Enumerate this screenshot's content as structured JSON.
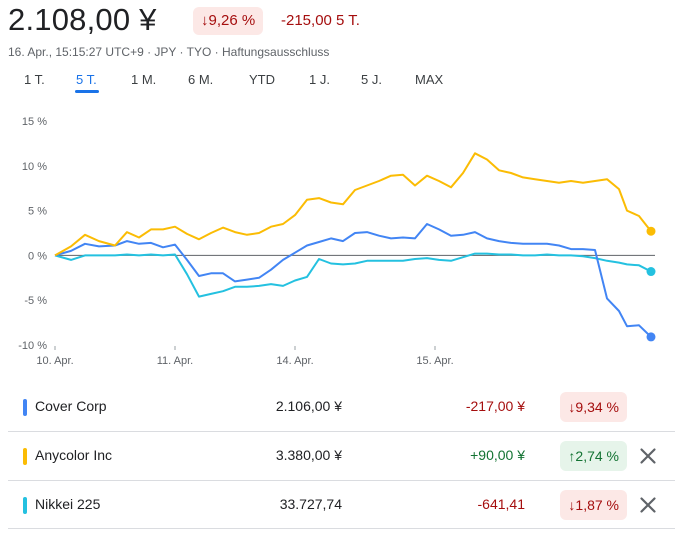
{
  "header": {
    "price": "2.108,00 ¥",
    "percent_change": "9,26 %",
    "abs_change": "-215,00 5 T.",
    "subline": "16. Apr., 15:15:27 UTC+9 · JPY · TYO · Haftungsausschluss",
    "down_color": "#a50e0e"
  },
  "tabs": [
    {
      "label": "1 T.",
      "active": false
    },
    {
      "label": "5 T.",
      "active": true
    },
    {
      "label": "1 M.",
      "active": false
    },
    {
      "label": "6 M.",
      "active": false
    },
    {
      "label": "YTD",
      "active": false
    },
    {
      "label": "1 J.",
      "active": false
    },
    {
      "label": "5 J.",
      "active": false
    },
    {
      "label": "MAX",
      "active": false
    }
  ],
  "chart_data": {
    "type": "line",
    "x_tick_labels": [
      "10. Apr.",
      "11. Apr.",
      "14. Apr.",
      "15. Apr."
    ],
    "x_tick_positions": [
      0,
      6,
      12,
      19
    ],
    "x_range": [
      0,
      30
    ],
    "ylim": [
      -10,
      15
    ],
    "y_ticks": [
      15,
      10,
      5,
      0,
      -5,
      -10
    ],
    "y_tick_labels": [
      "15 %",
      "10 %",
      "5 %",
      "0 %",
      "-5 %",
      "-10 %"
    ],
    "baseline": 0,
    "series": [
      {
        "name": "Cover Corp",
        "color": "#4285f4",
        "x": [
          0,
          0.8,
          1.5,
          2.2,
          3,
          3.6,
          4.2,
          4.8,
          5.4,
          6,
          6.6,
          7.2,
          7.8,
          8.4,
          9,
          9.6,
          10.2,
          10.8,
          11.4,
          12,
          12.6,
          13.2,
          13.8,
          14.4,
          15,
          15.6,
          16.2,
          16.8,
          17.4,
          18,
          18.6,
          19.2,
          19.8,
          20.4,
          21,
          21.6,
          22.2,
          22.8,
          23.4,
          24,
          24.6,
          25.2,
          25.8,
          26.4,
          27,
          27.6,
          28.2,
          28.6,
          29.2,
          29.8
        ],
        "y": [
          0,
          0.5,
          1.3,
          1.0,
          1.1,
          1.6,
          1.3,
          1.4,
          0.9,
          1.2,
          -0.5,
          -2.3,
          -2.0,
          -2.0,
          -2.9,
          -2.7,
          -2.5,
          -1.6,
          -0.5,
          0.3,
          1.1,
          1.5,
          1.9,
          1.6,
          2.5,
          2.6,
          2.2,
          1.9,
          2.0,
          1.9,
          3.5,
          2.9,
          2.2,
          2.3,
          2.6,
          1.9,
          1.6,
          1.4,
          1.3,
          1.3,
          1.3,
          1.1,
          0.7,
          0.7,
          0.6,
          -4.8,
          -6.2,
          -7.9,
          -7.8,
          -9.1
        ]
      },
      {
        "name": "Anycolor Inc",
        "color": "#fbbc04",
        "x": [
          0,
          0.8,
          1.5,
          2.2,
          3,
          3.6,
          4.2,
          4.8,
          5.4,
          6,
          6.6,
          7.2,
          7.8,
          8.4,
          9,
          9.6,
          10.2,
          10.8,
          11.4,
          12,
          12.6,
          13.2,
          13.8,
          14.4,
          15,
          15.6,
          16.2,
          16.8,
          17.4,
          18,
          18.6,
          19.2,
          19.8,
          20.4,
          21,
          21.6,
          22.2,
          22.8,
          23.4,
          24,
          24.6,
          25.2,
          25.8,
          26.4,
          27,
          27.6,
          28.2,
          28.6,
          29.2,
          29.8
        ],
        "y": [
          0,
          1.0,
          2.3,
          1.6,
          1.1,
          2.6,
          2.0,
          2.9,
          2.9,
          3.2,
          2.4,
          1.8,
          2.5,
          3.1,
          2.6,
          2.3,
          2.5,
          3.2,
          3.5,
          4.5,
          6.2,
          6.4,
          5.9,
          5.7,
          7.3,
          7.8,
          8.3,
          8.9,
          9.0,
          7.8,
          8.9,
          8.3,
          7.6,
          9.2,
          11.4,
          10.7,
          9.5,
          9.2,
          8.7,
          8.5,
          8.3,
          8.1,
          8.3,
          8.1,
          8.3,
          8.5,
          7.4,
          5.0,
          4.4,
          2.7
        ]
      },
      {
        "name": "Nikkei 225",
        "color": "#24c1e0",
        "x": [
          0,
          0.8,
          1.5,
          2.2,
          3,
          3.6,
          4.2,
          4.8,
          5.4,
          6,
          6.6,
          7.2,
          7.8,
          8.4,
          9,
          9.6,
          10.2,
          10.8,
          11.4,
          12,
          12.6,
          13.2,
          13.8,
          14.4,
          15,
          15.6,
          16.2,
          16.8,
          17.4,
          18,
          18.6,
          19.2,
          19.8,
          20.4,
          21,
          21.6,
          22.2,
          22.8,
          23.4,
          24,
          24.6,
          25.2,
          25.8,
          26.4,
          27,
          27.6,
          28.2,
          28.6,
          29.2,
          29.8
        ],
        "y": [
          0,
          -0.5,
          0.0,
          0.0,
          0.0,
          0.1,
          0.0,
          0.1,
          0.0,
          0.1,
          -2.1,
          -4.6,
          -4.3,
          -4.0,
          -3.5,
          -3.5,
          -3.4,
          -3.2,
          -3.4,
          -2.8,
          -2.4,
          -0.4,
          -0.9,
          -1.0,
          -0.9,
          -0.6,
          -0.6,
          -0.6,
          -0.6,
          -0.4,
          -0.3,
          -0.5,
          -0.6,
          -0.2,
          0.2,
          0.2,
          0.1,
          0.1,
          0.0,
          0.0,
          0.1,
          0.0,
          0.0,
          -0.1,
          -0.3,
          -0.6,
          -0.8,
          -1.0,
          -1.1,
          -1.8
        ]
      }
    ]
  },
  "comparison_rows": [
    {
      "name": "Cover Corp",
      "color": "#4285f4",
      "price": "2.106,00 ¥",
      "change": "-217,00 ¥",
      "change_color": "#a50e0e",
      "percent": "9,34 %",
      "direction": "down",
      "removable": false
    },
    {
      "name": "Anycolor Inc",
      "color": "#fbbc04",
      "price": "3.380,00 ¥",
      "change": "+90,00 ¥",
      "change_color": "#137333",
      "percent": "2,74 %",
      "direction": "up",
      "removable": true
    },
    {
      "name": "Nikkei 225",
      "color": "#24c1e0",
      "price": "33.727,74",
      "change": "-641,41",
      "change_color": "#a50e0e",
      "percent": "1,87 %",
      "direction": "down",
      "removable": true
    }
  ],
  "icons": {
    "down_arrow": "arrow-down-icon",
    "up_arrow": "arrow-up-icon",
    "close": "close-icon"
  }
}
